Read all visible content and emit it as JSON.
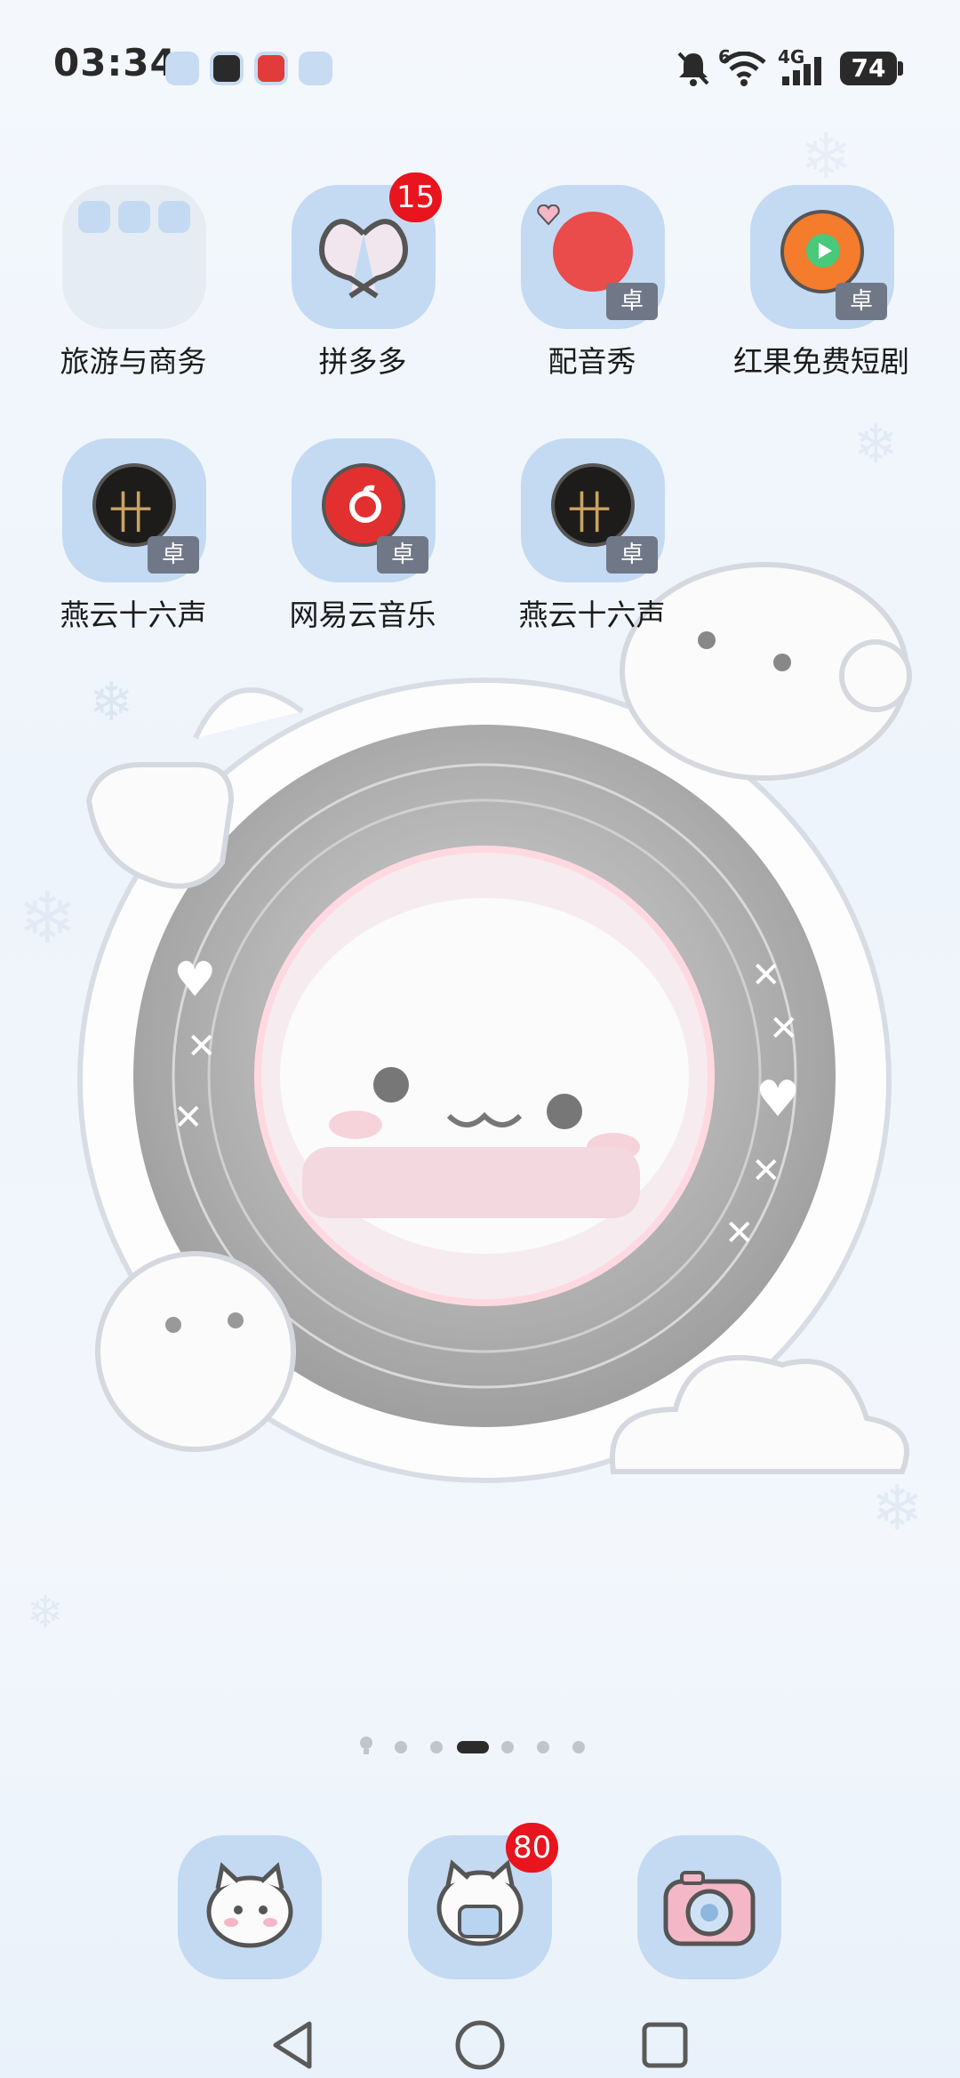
{
  "status_bar": {
    "time": "03:34",
    "notification_icons": [
      "folder-icon",
      "game-icon",
      "music-icon",
      "app-icon"
    ],
    "network_label": "4G",
    "wifi_label": "6",
    "battery": "74",
    "icons": [
      "mute-bell-icon",
      "wifi-icon",
      "signal-icon",
      "battery-icon"
    ]
  },
  "apps": [
    {
      "label": "旅游与商务",
      "kind": "folder"
    },
    {
      "label": "拼多多",
      "badge": "15"
    },
    {
      "label": "配音秀",
      "tag": "卓"
    },
    {
      "label": "红果免费短剧",
      "tag": "卓"
    },
    {
      "label": "燕云十六声",
      "tag": "卓"
    },
    {
      "label": "网易云音乐",
      "tag": "卓"
    },
    {
      "label": "燕云十六声",
      "tag": "卓"
    }
  ],
  "page_indicator": {
    "count": 6,
    "active_index": 3
  },
  "dock": {
    "items": [
      {
        "icon": "cat-phone-icon"
      },
      {
        "icon": "cat-message-icon",
        "badge": "80"
      },
      {
        "icon": "camera-icon"
      }
    ]
  },
  "nav_bar": {
    "icons": [
      "back-icon",
      "home-icon",
      "recents-icon"
    ]
  },
  "colors": {
    "badge": "#e8141e",
    "icon_tile": "#c4daf3"
  }
}
